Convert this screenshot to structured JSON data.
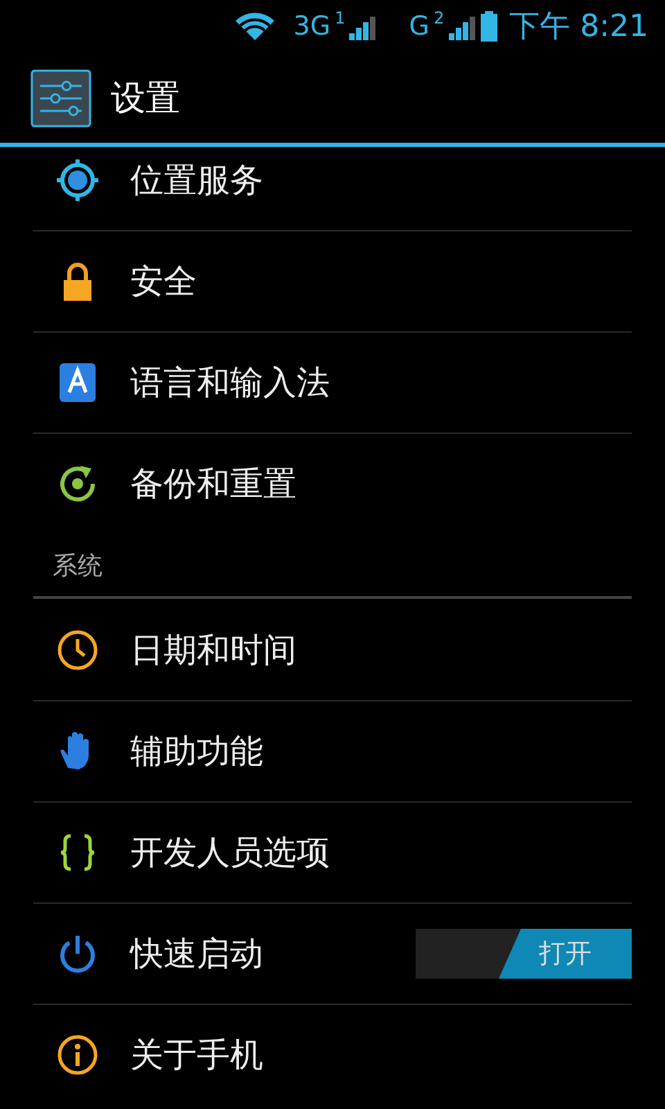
{
  "status_bar": {
    "network_1": "3G",
    "sim_1": "1",
    "network_2": "G",
    "sim_2": "2",
    "time": "下午 8:21"
  },
  "action_bar": {
    "title": "设置"
  },
  "sections": [
    {
      "items": [
        {
          "label": "位置服务"
        },
        {
          "label": "安全"
        },
        {
          "label": "语言和输入法"
        },
        {
          "label": "备份和重置"
        }
      ]
    },
    {
      "header": "系统",
      "items": [
        {
          "label": "日期和时间"
        },
        {
          "label": "辅助功能"
        },
        {
          "label": "开发人员选项"
        },
        {
          "label": "快速启动",
          "toggle": {
            "on": true,
            "label": "打开"
          }
        },
        {
          "label": "关于手机"
        }
      ]
    }
  ]
}
